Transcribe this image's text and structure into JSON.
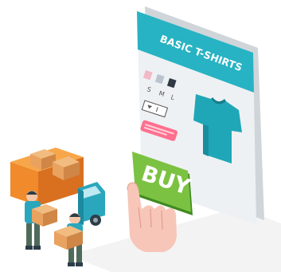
{
  "product_card": {
    "title": "BASIC T-SHIRTS",
    "sizes": [
      "S",
      "M",
      "L"
    ],
    "swatch_colors": [
      "#f2b8c6",
      "#b9c4cf",
      "#2f3a45"
    ],
    "shirt_color": "#1fa7b8",
    "accent_teal": "#27b3c3",
    "pink_bar_color": "#ff6f8e"
  },
  "buy_button": {
    "label": "BUY",
    "color": "#7cc242"
  },
  "delivery": {
    "truck_color": "#f08a2a",
    "box_color": "#e9a25f"
  }
}
